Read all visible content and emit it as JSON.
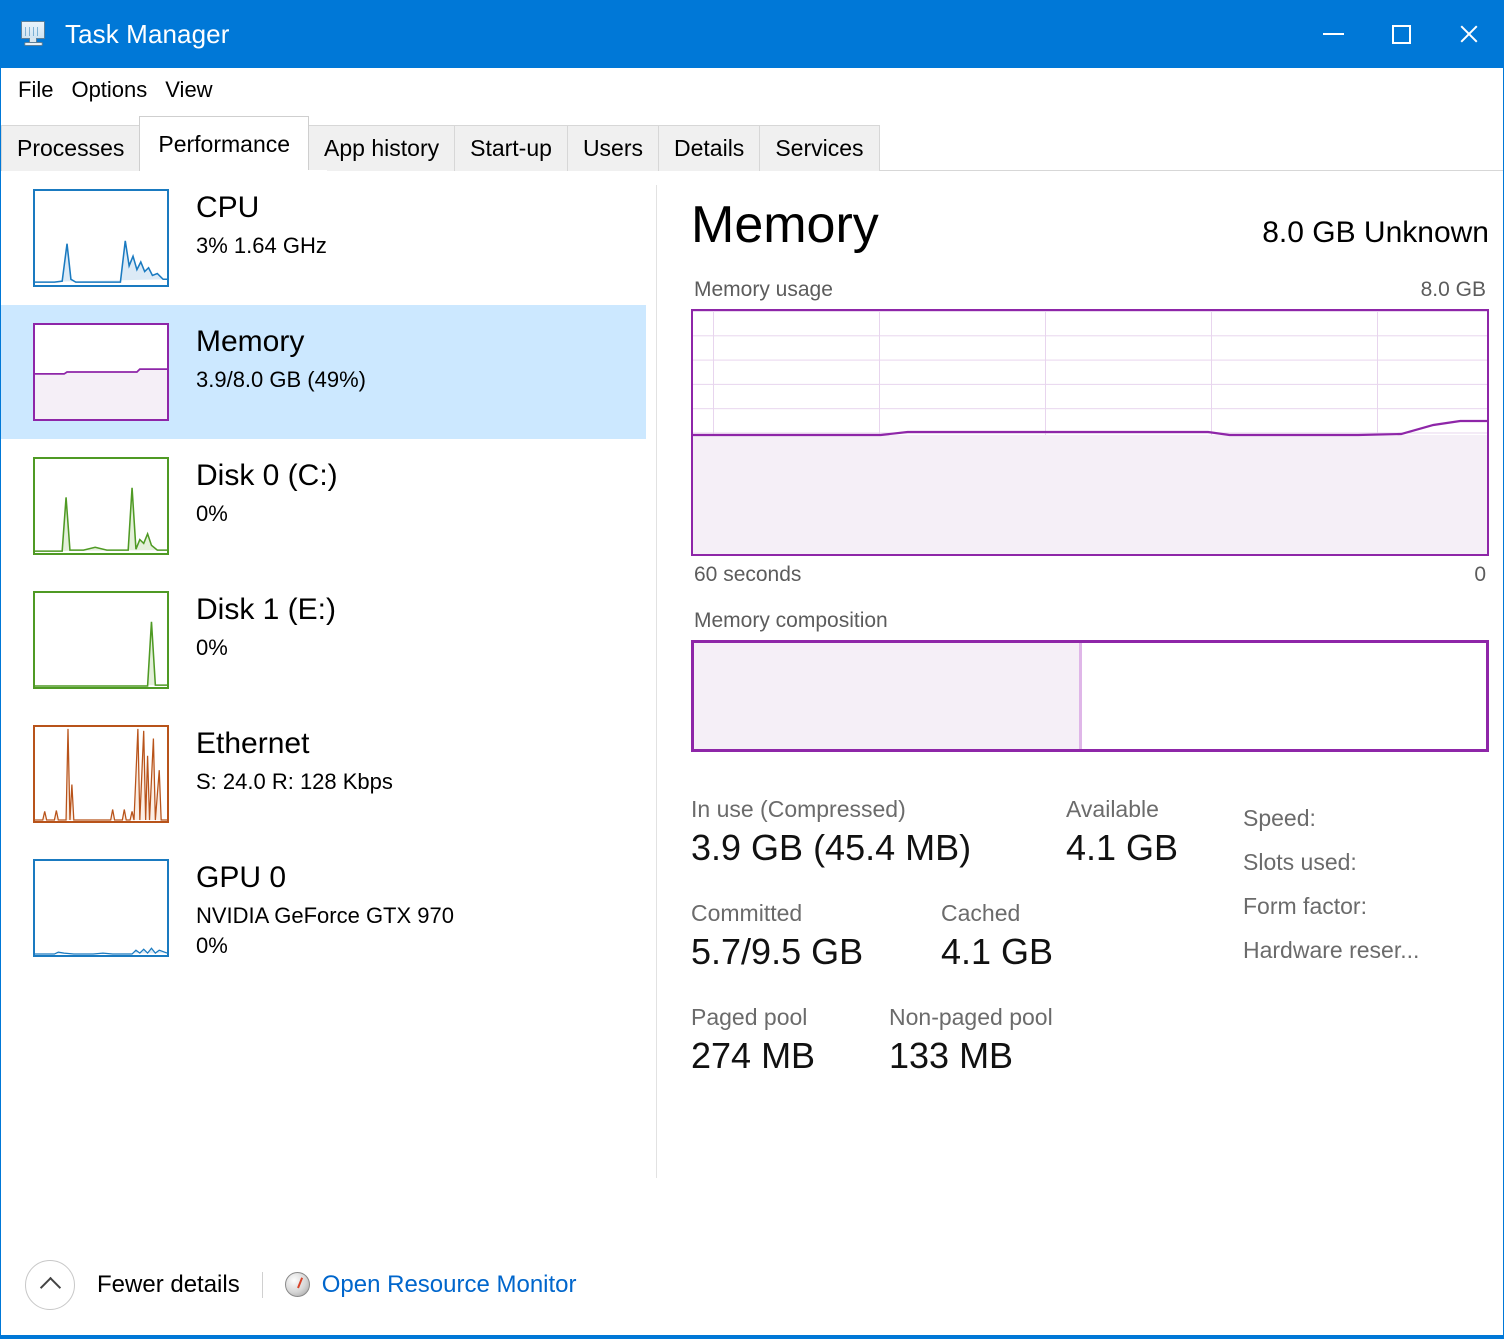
{
  "window": {
    "title": "Task Manager",
    "icon": "task-manager-icon",
    "accent": "#0078d7",
    "controls": {
      "minimize": "–",
      "maximize": "□",
      "close": "✕"
    }
  },
  "menu": {
    "items": [
      "File",
      "Options",
      "View"
    ]
  },
  "tabs": {
    "items": [
      "Processes",
      "Performance",
      "App history",
      "Start-up",
      "Users",
      "Details",
      "Services"
    ],
    "active": "Performance"
  },
  "sidebar": {
    "items": [
      {
        "title": "CPU",
        "sub": "3%  1.64 GHz",
        "sub2": "",
        "color": "#1a7ac0",
        "selected": false
      },
      {
        "title": "Memory",
        "sub": "3.9/8.0 GB (49%)",
        "sub2": "",
        "color": "#8e26a8",
        "selected": true
      },
      {
        "title": "Disk 0 (C:)",
        "sub": "0%",
        "sub2": "",
        "color": "#4f9a24",
        "selected": false
      },
      {
        "title": "Disk 1 (E:)",
        "sub": "0%",
        "sub2": "",
        "color": "#4f9a24",
        "selected": false
      },
      {
        "title": "Ethernet",
        "sub": "S: 24.0  R:  128 Kbps",
        "sub2": "",
        "color": "#b8531a",
        "selected": false
      },
      {
        "title": "GPU 0",
        "sub": "NVIDIA GeForce GTX 970",
        "sub2": "0%",
        "color": "#1a7ac0",
        "selected": false
      }
    ]
  },
  "detail": {
    "title": "Memory",
    "subtitle_right": "8.0 GB Unknown",
    "graph": {
      "label": "Memory usage",
      "max_label": "8.0 GB",
      "x_left": "60 seconds",
      "x_right": "0"
    },
    "composition": {
      "label": "Memory composition"
    },
    "stats": {
      "in_use_label": "In use (Compressed)",
      "in_use_value": "3.9 GB (45.4 MB)",
      "available_label": "Available",
      "available_value": "4.1 GB",
      "committed_label": "Committed",
      "committed_value": "5.7/9.5 GB",
      "cached_label": "Cached",
      "cached_value": "4.1 GB",
      "paged_label": "Paged pool",
      "paged_value": "274 MB",
      "nonpaged_label": "Non-paged pool",
      "nonpaged_value": "133 MB"
    },
    "hardware": [
      "Speed:",
      "Slots used:",
      "Form factor:",
      "Hardware reser..."
    ]
  },
  "footer": {
    "fewer_details": "Fewer details",
    "resource_monitor": "Open Resource Monitor",
    "link_color": "#0066cc"
  },
  "chart_data": {
    "type": "area",
    "title": "Memory usage",
    "ylabel": "",
    "xlabel": "60 seconds",
    "ylim": [
      0,
      8.0
    ],
    "y_unit": "GB",
    "y_max_label": "8.0 GB",
    "x_tick_labels": [
      "60 seconds",
      "0"
    ],
    "grid": true,
    "legend": "none",
    "series": [
      {
        "name": "Memory in use",
        "color": "#8e26a8",
        "fill": "#f5eff7",
        "x": [
          0,
          5,
          10,
          15,
          20,
          25,
          30,
          35,
          40,
          45,
          50,
          55,
          58,
          60
        ],
        "values": [
          3.88,
          3.88,
          3.88,
          3.9,
          3.91,
          3.91,
          3.91,
          3.9,
          3.89,
          3.89,
          3.89,
          3.94,
          4.0,
          4.02
        ]
      }
    ],
    "composition": {
      "type": "bar",
      "orientation": "horizontal-stacked",
      "categories": [
        "In use",
        "Available"
      ],
      "values": [
        3.9,
        4.1
      ],
      "percent": [
        49,
        51
      ],
      "total": 8.0
    }
  }
}
